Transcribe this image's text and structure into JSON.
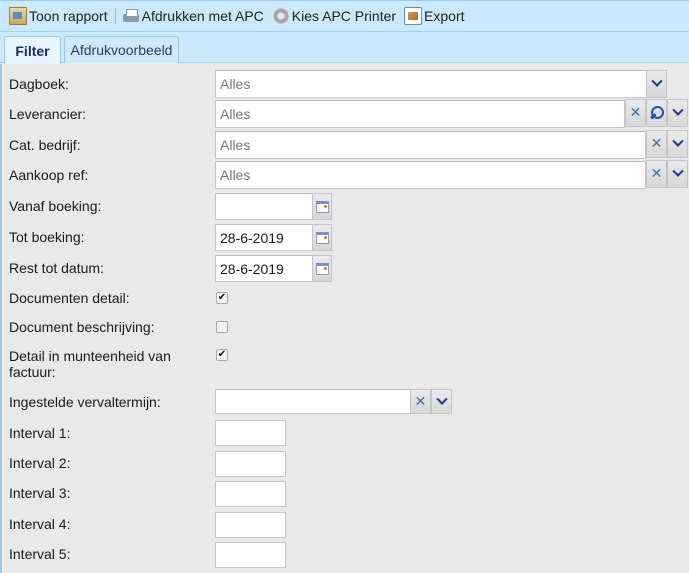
{
  "toolbar": {
    "items": [
      {
        "label": "Toon rapport",
        "icon": "report-icon"
      },
      {
        "label": "Afdrukken met APC",
        "icon": "printer-icon"
      },
      {
        "label": "Kies APC Printer",
        "icon": "gear-icon"
      },
      {
        "label": "Export",
        "icon": "export-icon"
      }
    ]
  },
  "tabs": [
    {
      "label": "Filter",
      "active": true
    },
    {
      "label": "Afdrukvoorbeeld",
      "active": false
    }
  ],
  "form": {
    "dagboek": {
      "label": "Dagboek:",
      "value": "Alles"
    },
    "leverancier": {
      "label": "Leverancier:",
      "value": "Alles"
    },
    "cat_bedrijf": {
      "label": "Cat. bedrijf:",
      "value": "Alles"
    },
    "aankoop_ref": {
      "label": "Aankoop ref:",
      "value": "Alles"
    },
    "vanaf_boeking": {
      "label": "Vanaf boeking:",
      "value": ""
    },
    "tot_boeking": {
      "label": "Tot boeking:",
      "value": "28-6-2019"
    },
    "rest_tot_datum": {
      "label": "Rest tot datum:",
      "value": "28-6-2019"
    },
    "documenten_detail": {
      "label": "Documenten detail:",
      "checked": true,
      "mark": "✔"
    },
    "document_beschrijving": {
      "label": "Document beschrijving:",
      "checked": false,
      "mark": ""
    },
    "detail_munteenheid": {
      "label_line1": "Detail in munteenheid van",
      "label_line2": "factuur:",
      "checked": true,
      "mark": "✔"
    },
    "vervaltermijn": {
      "label": "Ingestelde vervaltermijn:",
      "value": ""
    },
    "intervals": [
      {
        "label": "Interval 1:",
        "value": ""
      },
      {
        "label": "Interval 2:",
        "value": ""
      },
      {
        "label": "Interval 3:",
        "value": ""
      },
      {
        "label": "Interval 4:",
        "value": ""
      },
      {
        "label": "Interval 5:",
        "value": ""
      }
    ],
    "clear_symbol": "✕"
  }
}
